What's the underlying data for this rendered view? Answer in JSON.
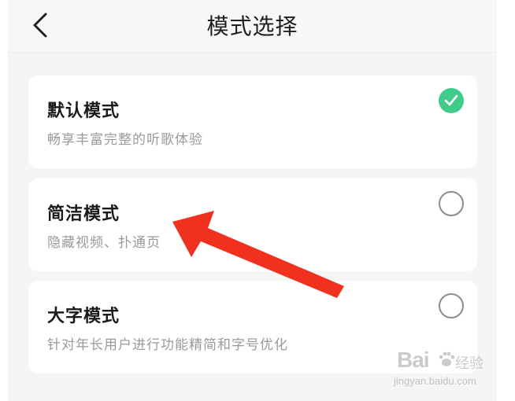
{
  "header": {
    "title": "模式选择",
    "back_icon": "chevron-left-icon"
  },
  "modes": [
    {
      "title": "默认模式",
      "description": "畅享丰富完整的听歌体验",
      "selected": true
    },
    {
      "title": "简洁模式",
      "description": "隐藏视频、扑通页",
      "selected": false
    },
    {
      "title": "大字模式",
      "description": "针对年长用户进行功能精简和字号优化",
      "selected": false
    }
  ],
  "colors": {
    "accent_green": "#3fcb8a",
    "annotation_arrow": "#f0311f",
    "background": "#f5f5f5",
    "card": "#ffffff"
  },
  "watermark": {
    "brand": "Bai",
    "brand_suffix": "u",
    "product": "经验",
    "url": "jingyan.baidu.com"
  }
}
